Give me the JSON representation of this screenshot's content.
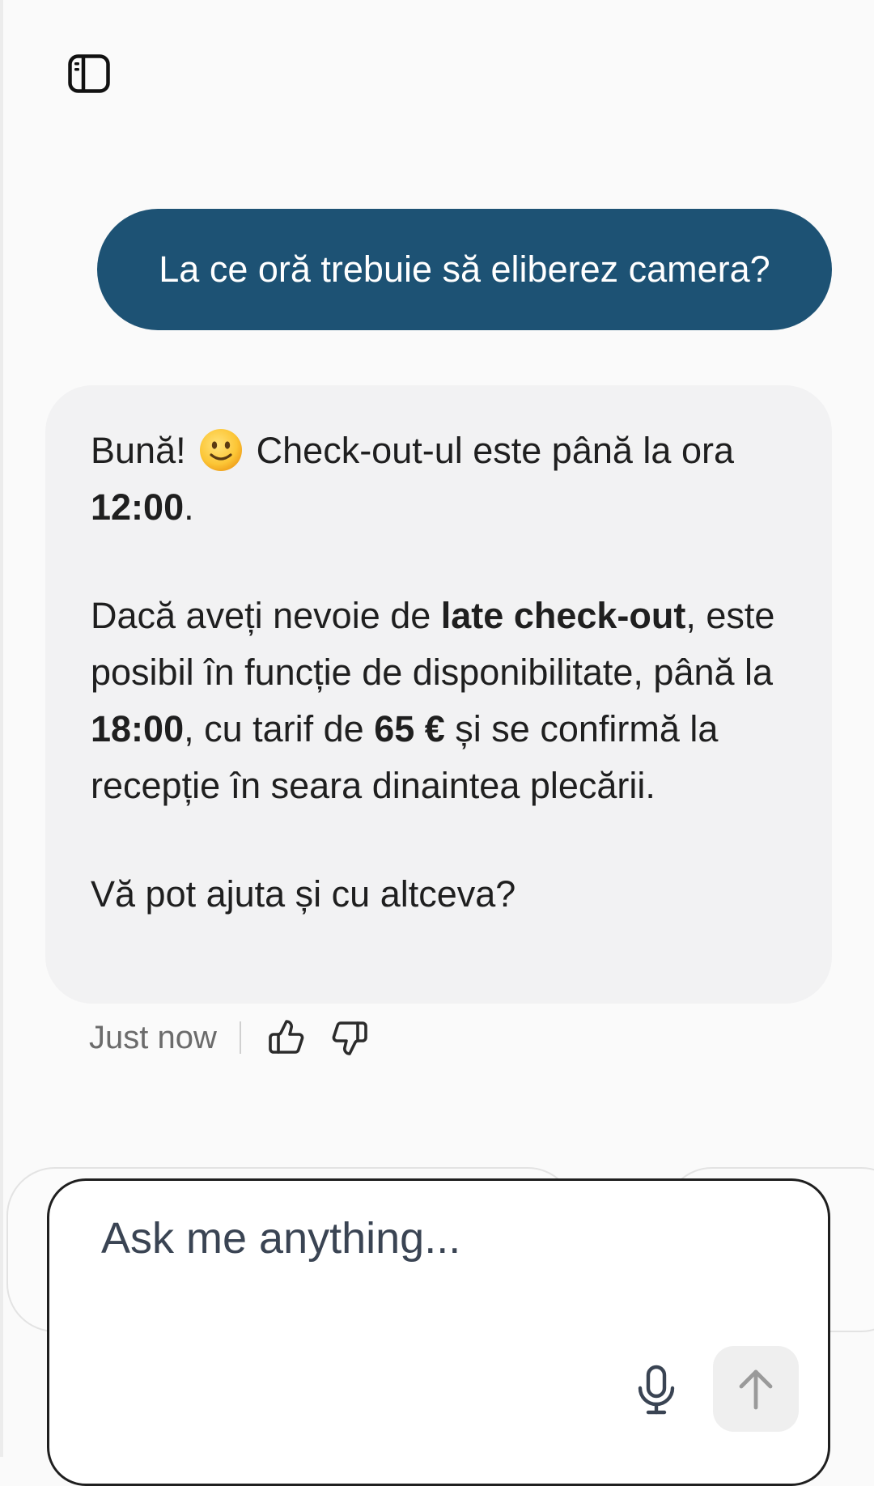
{
  "header": {
    "sidebar_icon": "sidebar-toggle-icon"
  },
  "chat": {
    "user_message": "La ce oră trebuie să eliberez camera?",
    "bot_message": {
      "p1_text1": "Bună!",
      "p1_text2": "Check-out-ul este până la ora",
      "p1_bold_time": "12:00",
      "p1_end": ".",
      "p2_text1": "Dacă aveți nevoie de ",
      "p2_bold_late": "late check-out",
      "p2_text2": ", este posibil în funcție de disponibilitate, până la ",
      "p2_bold_time": "18:00",
      "p2_text3": ", cu tarif de ",
      "p2_bold_price": "65 €",
      "p2_text4": " și se confirmă la recepție în seara dinaintea plecării.",
      "p3_text": "Vă pot ajuta și cu altceva?"
    },
    "timestamp": "Just now",
    "feedback_icons": [
      "thumbs-up-icon",
      "thumbs-down-icon"
    ]
  },
  "composer": {
    "placeholder": "Ask me anything...",
    "value": "",
    "mic_icon": "microphone-icon",
    "send_icon": "arrow-up-icon"
  },
  "colors": {
    "user_bubble": "#1d5274",
    "bot_bubble": "#f2f2f3",
    "background": "#fafafa",
    "send_button_bg": "#efefef"
  }
}
